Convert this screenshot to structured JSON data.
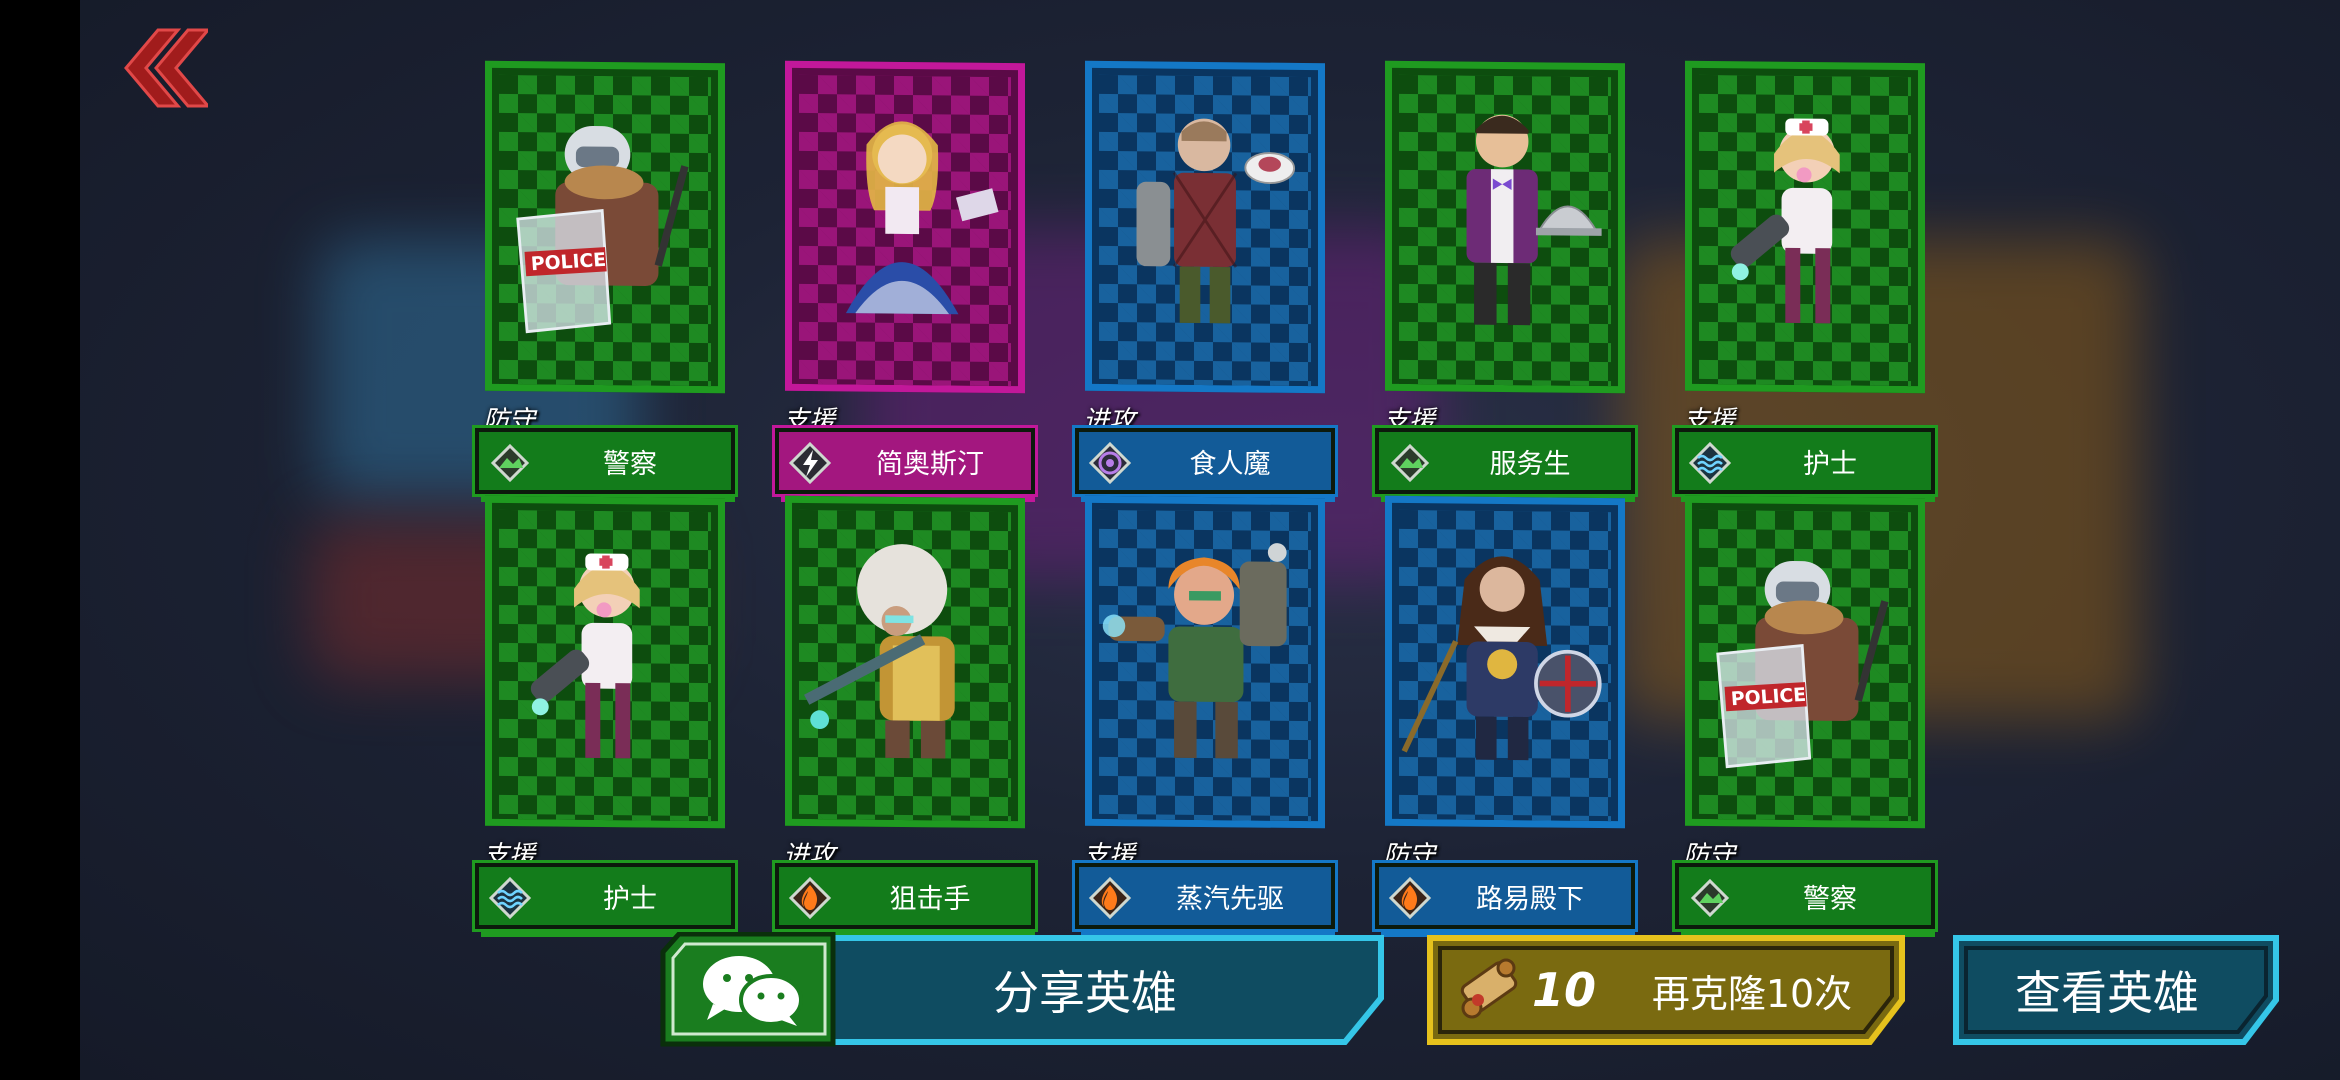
{
  "nav": {
    "back_icon": "double-chevron-left-icon"
  },
  "colors": {
    "green": "#1f9b20",
    "green_dark": "#0d4d0e",
    "green_plate": "#137c1b",
    "magenta": "#c2189a",
    "magenta_dark": "#5b0a47",
    "magenta_plate": "#a3177f",
    "blue": "#1478c6",
    "blue_dark": "#0a3560",
    "blue_plate": "#125b98",
    "gold": "#e6c21d",
    "cyan": "#35c6e8",
    "teal_btn": "#0f4c61"
  },
  "heroes": [
    {
      "role": "防守",
      "name": "警察",
      "element": "earth",
      "theme": "green",
      "char": "police"
    },
    {
      "role": "支援",
      "name": "简奥斯汀",
      "element": "lightning",
      "theme": "magenta",
      "char": "austen"
    },
    {
      "role": "进攻",
      "name": "食人魔",
      "element": "void",
      "theme": "blue",
      "char": "cannibal"
    },
    {
      "role": "支援",
      "name": "服务生",
      "element": "earth",
      "theme": "green",
      "char": "waiter"
    },
    {
      "role": "支援",
      "name": "护士",
      "element": "water",
      "theme": "green",
      "char": "nurse"
    },
    {
      "role": "支援",
      "name": "护士",
      "element": "water",
      "theme": "green",
      "char": "nurse"
    },
    {
      "role": "进攻",
      "name": "狙击手",
      "element": "fire",
      "theme": "green",
      "char": "sniper"
    },
    {
      "role": "支援",
      "name": "蒸汽先驱",
      "element": "fire",
      "theme": "blue",
      "char": "steam"
    },
    {
      "role": "防守",
      "name": "路易殿下",
      "element": "fire",
      "theme": "blue",
      "char": "louis"
    },
    {
      "role": "防守",
      "name": "警察",
      "element": "earth",
      "theme": "green",
      "char": "police"
    }
  ],
  "actions": {
    "share_label": "分享英雄",
    "share_icon": "wechat-icon",
    "clone_cost": "10",
    "clone_label": "再克隆10次",
    "clone_icon": "scroll-icon",
    "view_label": "查看英雄"
  }
}
